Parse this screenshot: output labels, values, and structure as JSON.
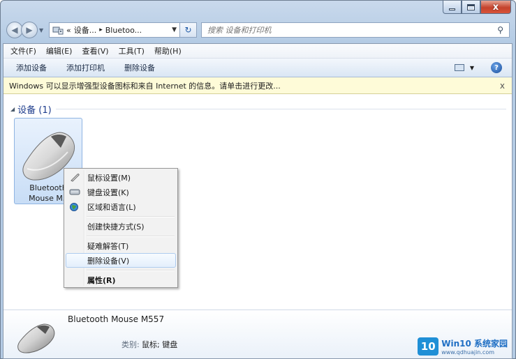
{
  "window": {
    "minimize_icon": "minimize-icon",
    "maximize_icon": "maximize-icon",
    "close_glyph": "x"
  },
  "address": {
    "prefix": "«",
    "crumb1": "设备...",
    "sep": "▸",
    "crumb2": "Bluetoo...",
    "search_placeholder": "搜索 设备和打印机"
  },
  "menubar": {
    "items": [
      "文件(F)",
      "编辑(E)",
      "查看(V)",
      "工具(T)",
      "帮助(H)"
    ]
  },
  "commands": {
    "add_device": "添加设备",
    "add_printer": "添加打印机",
    "remove_device": "删除设备",
    "help_glyph": "?"
  },
  "infobar": {
    "text": "Windows 可以显示增强型设备图标和来自 Internet 的信息。请单击进行更改...",
    "close": "x"
  },
  "group": {
    "title": "设备 (1)"
  },
  "device": {
    "name_line1": "Bluetooth",
    "name_line2": "Mouse M5"
  },
  "context_menu": {
    "mouse_settings": "鼠标设置(M)",
    "keyboard_settings": "键盘设置(K)",
    "region_language": "区域和语言(L)",
    "create_shortcut": "创建快捷方式(S)",
    "troubleshoot": "疑难解答(T)",
    "remove_device": "删除设备(V)",
    "properties": "属性(R)"
  },
  "details": {
    "device_name": "Bluetooth Mouse M557",
    "category_label": "类别:",
    "category_value": "鼠标; 键盘"
  },
  "watermark": {
    "logo": "10",
    "title": "Win10 系统家园",
    "url": "www.qdhuajin.com"
  },
  "colors": {
    "accent": "#1e3c8c",
    "infobar": "#fefbd8",
    "highlight_border": "#aeccef"
  }
}
